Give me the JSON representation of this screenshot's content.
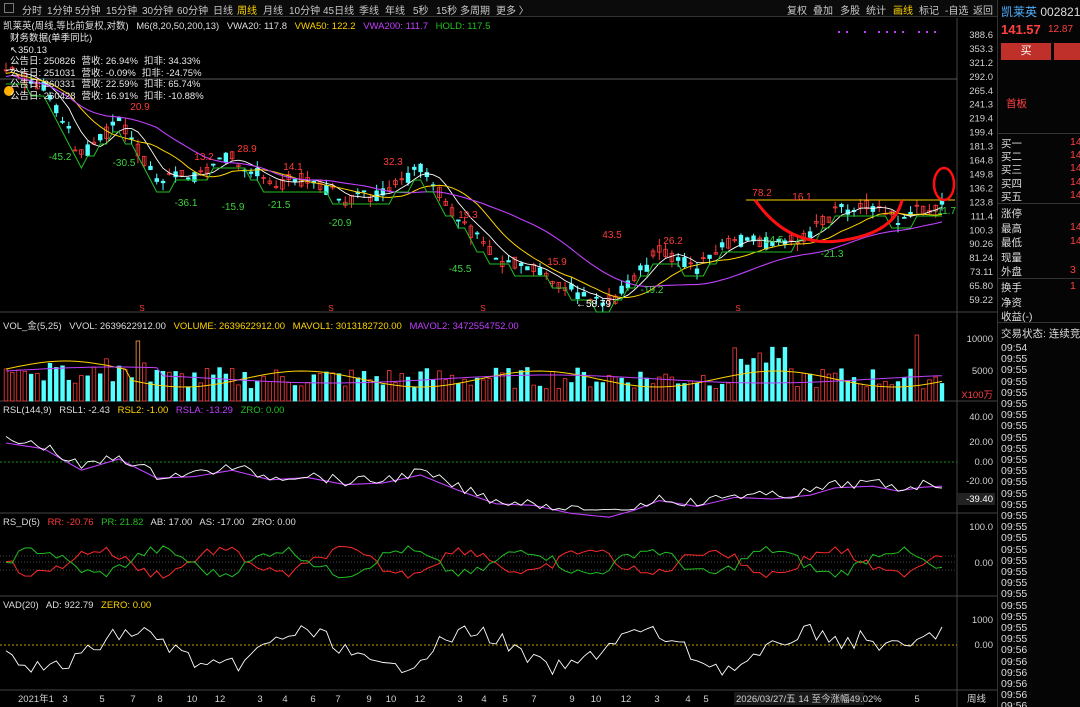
{
  "toolbar": {
    "timeframes": [
      "分时",
      "1分钟",
      "5分钟",
      "15分钟",
      "30分钟",
      "60分钟",
      "日线",
      "周线",
      "月线",
      "10分钟",
      "45日线",
      "季线",
      "年线",
      "5秒",
      "15秒",
      "多周期",
      "更多 〉"
    ],
    "active_timeframe": "周线",
    "tools": [
      "复权",
      "叠加",
      "多股",
      "统计",
      "画线",
      "标记",
      "-自选",
      "返回"
    ],
    "active_tool": "画线"
  },
  "main": {
    "title": "凯莱英(周线,等比前复权,对数)",
    "ma_label": "M6(8,20,50,200,13)",
    "vwa20": "VWA20: 117.8",
    "vwa50": "VWA50: 122.2",
    "vwa200": "VWA200: 111.7",
    "hold": "HOLD: 117.5",
    "notes_title": "财务数据(单季同比)",
    "notes_high": "350.13",
    "notes": [
      {
        "date": "公告日: 250826",
        "rev": "营收: 26.94%",
        "profit": "扣非: 34.33%"
      },
      {
        "date": "公告日: 251031",
        "rev": "营收: -0.09%",
        "profit": "扣非: -24.75%"
      },
      {
        "date": "公告日: 260331",
        "rev": "营收: 22.59%",
        "profit": "扣非: 65.74%"
      },
      {
        "date": "公告日: 260428",
        "rev": "营收: 16.91%",
        "profit": "扣非: -10.88%"
      }
    ],
    "y_ticks": [
      "388.6",
      "353.3",
      "321.2",
      "292.0",
      "265.4",
      "241.3",
      "219.4",
      "199.4",
      "181.3",
      "164.8",
      "149.8",
      "136.2",
      "123.8",
      "111.4",
      "100.3",
      "90.26",
      "81.24",
      "73.11",
      "65.80",
      "59.22"
    ],
    "swing_labels": [
      "-45.2",
      "-30.5",
      "20.9",
      "13.2",
      "-36.1",
      "-15.9",
      "28.9",
      "14.1",
      "-21.5",
      "-20.9",
      "32.3",
      "19.3",
      "-45.5",
      "15.9",
      "43.5",
      "26.2",
      "-19.2",
      "78.2",
      "16.1",
      "-14.5",
      "-21.3",
      "-11.7"
    ],
    "low_label": "58.79"
  },
  "volume": {
    "label": "VOL_金(5,25)",
    "vvol": "VVOL: 2639622912.00",
    "volume": "VOLUME: 2639622912.00",
    "mavol1": "MAVOL1: 3013182720.00",
    "mavol2": "MAVOL2: 3472554752.00",
    "y_ticks": [
      "10000",
      "5000"
    ],
    "unit": "X100万"
  },
  "rsl": {
    "label": "RSL(144,9)",
    "rsl1": "RSL1: -2.43",
    "rsl2": "RSL2: -1.00",
    "rsla": "RSLA: -13.29",
    "zro": "ZRO: 0.00",
    "y_ticks": [
      "40.00",
      "20.00",
      "0.00",
      "-20.00"
    ],
    "current": "-39.40"
  },
  "rsd": {
    "label": "RS_D(5)",
    "rr": "RR: -20.76",
    "pr": "PR: 21.82",
    "ab": "AB: 17.00",
    "as": "AS: -17.00",
    "zro": "ZRO: 0.00",
    "y_ticks": [
      "100.0",
      "0.00"
    ]
  },
  "vad": {
    "label": "VAD(20)",
    "ad": "AD: 922.79",
    "zero": "ZERO: 0.00",
    "y_ticks": [
      "1000",
      "0.00"
    ]
  },
  "x_axis": {
    "labels": [
      "2021年1",
      "3",
      "5",
      "7",
      "8",
      "10",
      "12",
      "3",
      "4",
      "6",
      "7",
      "9",
      "10",
      "12",
      "3",
      "4",
      "5",
      "7",
      "9",
      "10",
      "12",
      "3",
      "4",
      "5",
      "5"
    ],
    "cursor_text": "2026/03/27/五 14 至今涨幅49.02%",
    "period": "周线"
  },
  "panel": {
    "name": "凯莱英",
    "code": "002821",
    "price": "141.57",
    "change": "12.87",
    "buy": "买",
    "board": "首板",
    "book": [
      "买一",
      "买二",
      "买三",
      "买四",
      "买五"
    ],
    "book_vals": [
      "14",
      "14",
      "14",
      "14",
      "14"
    ],
    "stats": [
      "涨停",
      "最高",
      "最低",
      "现量",
      "外盘"
    ],
    "stats_vals": [
      "",
      "14",
      "14",
      "",
      "3"
    ],
    "stats2": [
      "换手",
      "净资",
      "收益(-)"
    ],
    "stats2_vals": [
      "1",
      "",
      ""
    ],
    "trade_status": "交易状态: 连续竞",
    "times": [
      "09:54",
      "09:55",
      "09:55",
      "09:55",
      "09:55",
      "09:55",
      "09:55",
      "09:55",
      "09:55",
      "09:55",
      "09:55",
      "09:55",
      "09:55",
      "09:55",
      "09:55",
      "09:55",
      "09:55",
      "09:55",
      "09:55",
      "09:55",
      "09:55",
      "09:55",
      "09:55",
      "09:55",
      "09:55",
      "09:55",
      "09:55",
      "09:56",
      "09:56",
      "09:56",
      "09:56",
      "09:56",
      "09:56"
    ]
  },
  "colors": {
    "up": "#ff3b3b",
    "down": "#54ffff",
    "ma_yellow": "#ffd400",
    "ma_green": "#22c022",
    "ma_magenta": "#c040ff",
    "highlight_red": "#ff1010"
  }
}
